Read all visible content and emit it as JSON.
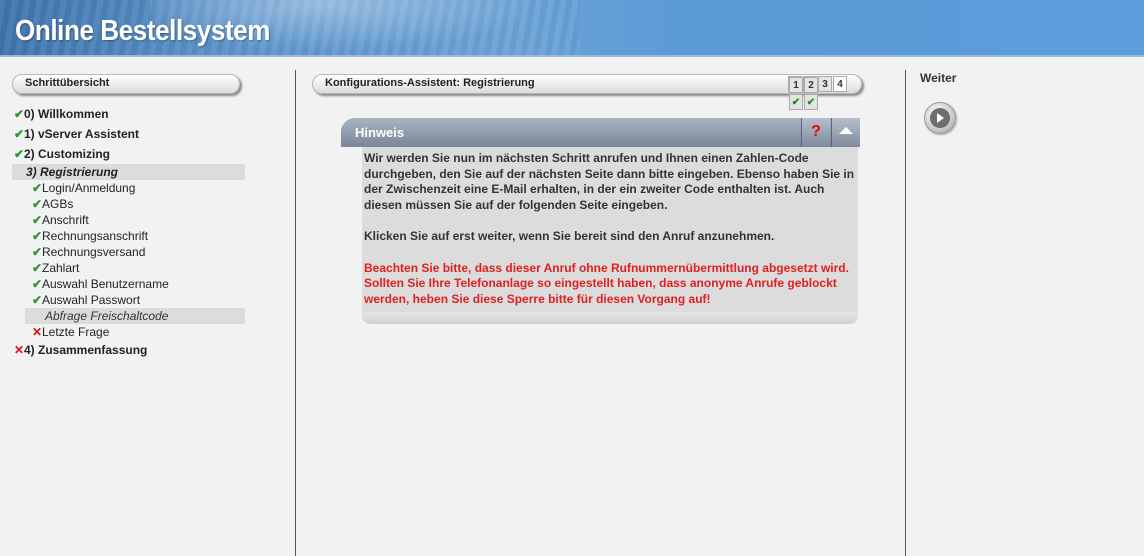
{
  "header": {
    "title": "Online Bestellsystem"
  },
  "sidebar": {
    "title": "Schrittübersicht",
    "items": [
      {
        "status": "done",
        "label": "0) Willkommen",
        "level": "top"
      },
      {
        "status": "done",
        "label": "1) vServer Assistent",
        "level": "top"
      },
      {
        "status": "done",
        "label": "2) Customizing",
        "level": "top"
      },
      {
        "status": "current",
        "label": "3) Registrierung",
        "level": "top"
      },
      {
        "status": "done",
        "label": "Login/Anmeldung",
        "level": "sub"
      },
      {
        "status": "done",
        "label": "AGBs",
        "level": "sub"
      },
      {
        "status": "done",
        "label": "Anschrift",
        "level": "sub"
      },
      {
        "status": "done",
        "label": "Rechnungsanschrift",
        "level": "sub"
      },
      {
        "status": "done",
        "label": "Rechnungsversand",
        "level": "sub"
      },
      {
        "status": "done",
        "label": "Zahlart",
        "level": "sub"
      },
      {
        "status": "done",
        "label": "Auswahl Benutzername",
        "level": "sub"
      },
      {
        "status": "done",
        "label": "Auswahl Passwort",
        "level": "sub"
      },
      {
        "status": "current",
        "label": "Abfrage Freischaltcode",
        "level": "sub"
      },
      {
        "status": "open",
        "label": "Letzte Frage",
        "level": "sub"
      },
      {
        "status": "open",
        "label": "4) Zusammenfassung",
        "level": "top"
      }
    ]
  },
  "main": {
    "title": "Konfigurations-Assistent: Registrierung",
    "steps": [
      "1",
      "2",
      "3",
      "4"
    ],
    "hinweis": {
      "title": "Hinweis",
      "help": "?",
      "para1": "Wir werden Sie nun im nächsten Schritt anrufen und Ihnen einen Zahlen-Code durchgeben, den Sie auf der nächsten Seite dann bitte eingeben. Ebenso haben Sie in der Zwischenzeit eine E-Mail erhalten, in der ein zweiter Code enthalten ist. Auch diesen müssen Sie auf der folgenden Seite eingeben.",
      "para2": "Klicken Sie auf erst weiter, wenn Sie bereit sind den Anruf anzunehmen.",
      "para3": "Beachten Sie bitte, dass dieser Anruf ohne Rufnummernübermittlung abgesetzt wird. Sollten Sie Ihre Telefonanlage so eingestellt haben, dass anonyme Anrufe geblockt werden, heben Sie diese Sperre bitte für diesen Vorgang auf!"
    }
  },
  "right": {
    "weiter_label": "Weiter"
  },
  "colors": {
    "ok": "#2a9a2a",
    "error": "#e02020",
    "header": "#5a93cb"
  }
}
